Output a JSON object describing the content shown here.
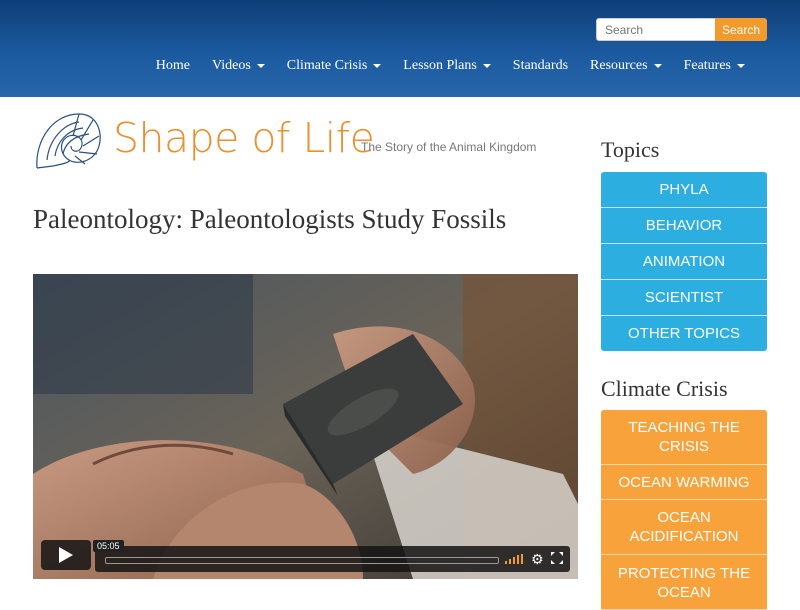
{
  "header": {
    "search_placeholder": "Search",
    "search_button": "Search",
    "nav": [
      {
        "label": "Home",
        "dropdown": false
      },
      {
        "label": "Videos",
        "dropdown": true
      },
      {
        "label": "Climate Crisis",
        "dropdown": true
      },
      {
        "label": "Lesson Plans",
        "dropdown": true
      },
      {
        "label": "Standards",
        "dropdown": false
      },
      {
        "label": "Resources",
        "dropdown": true
      },
      {
        "label": "Features",
        "dropdown": true
      }
    ]
  },
  "logo": {
    "text": "Shape of Life",
    "tagline": "The Story of the Animal Kingdom",
    "icon": "nautilus-shell-icon"
  },
  "page_title": "Paleontology: Paleontologists Study Fossils",
  "video": {
    "time": "05:05",
    "progress": 0
  },
  "sidebar": {
    "topics_heading": "Topics",
    "topics": [
      "PHYLA",
      "BEHAVIOR",
      "ANIMATION",
      "SCIENTIST",
      "OTHER TOPICS"
    ],
    "climate_heading": "Climate Crisis",
    "climate_items": [
      "TEACHING THE CRISIS",
      "OCEAN WARMING",
      "OCEAN ACIDIFICATION",
      "PROTECTING THE OCEAN"
    ]
  },
  "colors": {
    "header": "#1c5a9f",
    "accent_orange": "#f39a2c",
    "topic_blue": "#2cafe0",
    "climate_orange": "#f7a23b",
    "logo_orange": "#e9902f"
  }
}
